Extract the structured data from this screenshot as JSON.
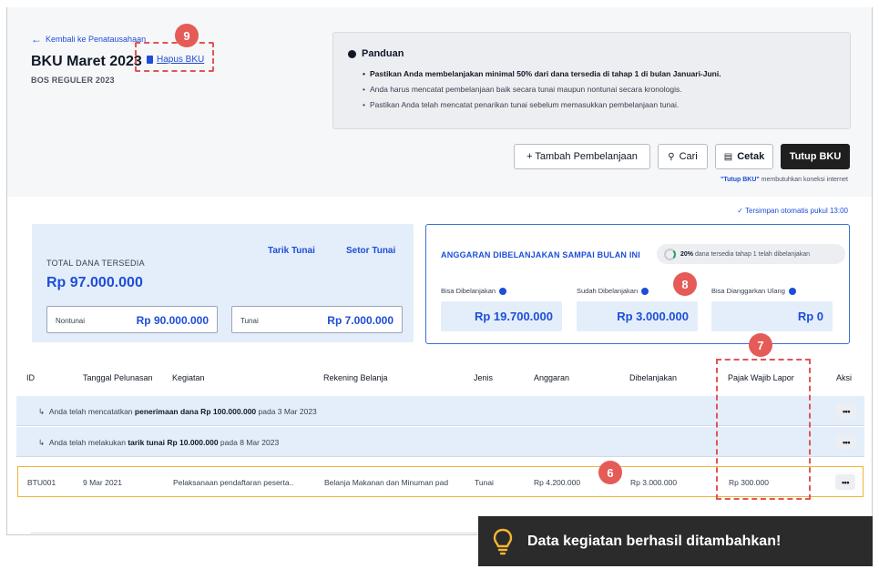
{
  "header": {
    "back_label": "Kembali ke Penatausahaan",
    "title": "BKU Maret 2023",
    "subtitle": "BOS REGULER 2023",
    "delete_label": "Hapus BKU"
  },
  "guide": {
    "title": "Panduan",
    "items": [
      "Pastikan Anda membelanjakan minimal 50% dari dana tersedia di tahap 1 di bulan Januari-Juni.",
      "Anda harus mencatat pembelanjaan baik secara tunai maupun nontunai secara kronologis.",
      "Pastikan Anda telah mencatat penarikan tunai sebelum memasukkan pembelanjaan tunai."
    ]
  },
  "toolbar": {
    "add_label": "+ Tambah Pembelanjaan",
    "search_label": "Cari",
    "print_label": "Cetak",
    "close_label": "Tutup BKU",
    "note_bold": "\"Tutup BKU\"",
    "note_rest": " membutuhkan koneksi internet"
  },
  "autosave": "✓ Tersimpan otomatis pukul 13:00",
  "funds": {
    "label": "TOTAL DANA TERSEDIA",
    "total": "Rp 97.000.000",
    "withdraw_label": "Tarik Tunai",
    "deposit_label": "Setor Tunai",
    "noncash_label": "Nontunai",
    "noncash_value": "Rp 90.000.000",
    "cash_label": "Tunai",
    "cash_value": "Rp 7.000.000"
  },
  "budget": {
    "title": "ANGGARAN DIBELANJAKAN SAMPAI BULAN INI",
    "progress_bold": "20%",
    "progress_text": " dana tersedia tahap 1 telah dibelanjakan",
    "progress_fraction": 0.2,
    "can_spend_label": "Bisa Dibelanjakan",
    "can_spend_value": "Rp 19.700.000",
    "spent_label": "Sudah Dibelanjakan",
    "spent_value": "Rp 3.000.000",
    "rebudget_label": "Bisa Dianggarkan Ulang",
    "rebudget_value": "Rp 0"
  },
  "table": {
    "headers": [
      "ID",
      "Tanggal Pelunasan",
      "Kegiatan",
      "Rekening Belanja",
      "Jenis",
      "Anggaran",
      "Dibelanjakan",
      "Pajak Wajib Lapor",
      "Aksi"
    ],
    "info_rows": [
      {
        "prefix": "Anda telah mencatatkan ",
        "bold": "penerimaan dana Rp 100.000.000",
        "suffix": " pada 3 Mar 2023"
      },
      {
        "prefix": "Anda telah melakukan ",
        "bold": "tarik tunai Rp 10.000.000",
        "suffix": " pada 8 Mar 2023"
      }
    ],
    "row": {
      "id": "BTU001",
      "date": "9 Mar 2021",
      "activity": "Pelaksanaan pendaftaran peserta..",
      "account": "Belanja Makanan dan Minuman pad",
      "type": "Tunai",
      "budget": "Rp 4.200.000",
      "spent": "Rp 3.000.000",
      "tax": "Rp 300.000"
    },
    "more_label": "•••"
  },
  "annotations": {
    "b9": "9",
    "b8": "8",
    "b7": "7",
    "b6": "6"
  },
  "toast": {
    "message": "Data kegiatan berhasil ditambahkan!"
  },
  "colors": {
    "accent": "#1d4ed8",
    "annotation": "#e45b57",
    "highlight_row": "#f0b43c"
  }
}
